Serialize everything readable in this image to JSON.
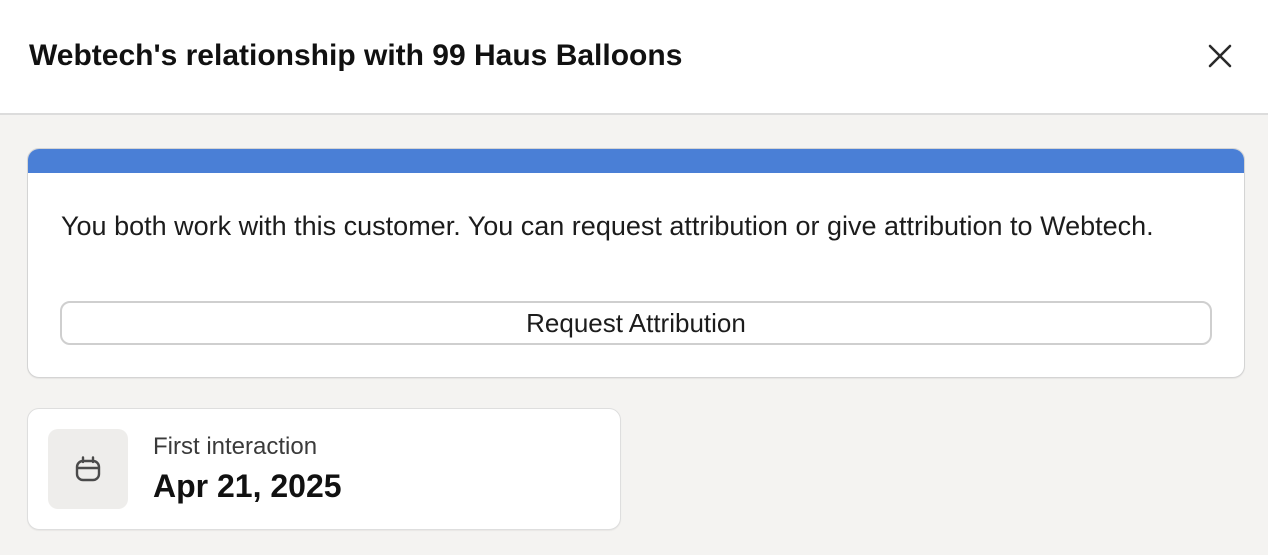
{
  "dialog": {
    "title": "Webtech's relationship with 99 Haus Balloons",
    "close_icon": "close-icon"
  },
  "banner": {
    "accent_color": "#4a7fd6",
    "message": "You both work with this customer. You can request attribution or give attribution to Webtech.",
    "request_button_label": "Request Attribution"
  },
  "first_interaction": {
    "icon": "calendar-icon",
    "label": "First interaction",
    "value": "Apr 21, 2025"
  }
}
